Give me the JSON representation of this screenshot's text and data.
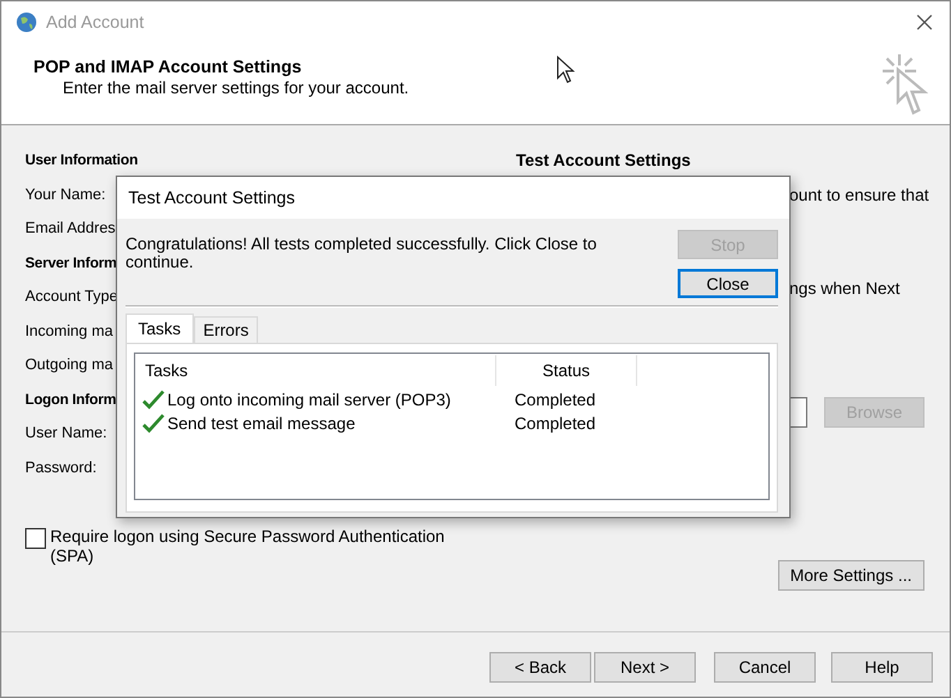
{
  "window": {
    "title": "Add Account"
  },
  "header": {
    "title": "POP and IMAP Account Settings",
    "subtitle": "Enter the mail server settings for your account."
  },
  "left_sections": [
    {
      "heading": "User Information",
      "labels": [
        "Your Name:",
        "Email Addres"
      ]
    },
    {
      "heading": "Server Inform",
      "labels": [
        "Account Type",
        "Incoming ma",
        "Outgoing ma"
      ]
    },
    {
      "heading": "Logon Inform",
      "labels": [
        "User Name:",
        "Password:"
      ]
    }
  ],
  "right_section": {
    "heading": "Test Account Settings",
    "text_1": "ount to ensure that",
    "text_2": "ngs when Next",
    "browse_button": {
      "label": "Browse",
      "disabled": true
    }
  },
  "spa_checkbox": {
    "label": "Require logon using Secure Password Authentication (SPA)",
    "checked": false
  },
  "more_settings_button": "More Settings ...",
  "buttons": [
    "< Back",
    "Next >",
    "Cancel",
    "Help"
  ],
  "dialog": {
    "title": "Test Account Settings",
    "message": "Congratulations! All tests completed successfully. Click Close to continue.",
    "buttons": [
      {
        "label": "Stop",
        "disabled": true,
        "focused": false
      },
      {
        "label": "Close",
        "disabled": false,
        "focused": true
      }
    ],
    "tabs": [
      {
        "label": "Tasks",
        "selected": true
      },
      {
        "label": "Errors",
        "selected": false
      }
    ],
    "columns": [
      "Tasks",
      "Status"
    ],
    "rows": [
      {
        "task": "Log onto incoming mail server (POP3)",
        "status": "Completed",
        "done": true
      },
      {
        "task": "Send test email message",
        "status": "Completed",
        "done": true
      }
    ]
  }
}
